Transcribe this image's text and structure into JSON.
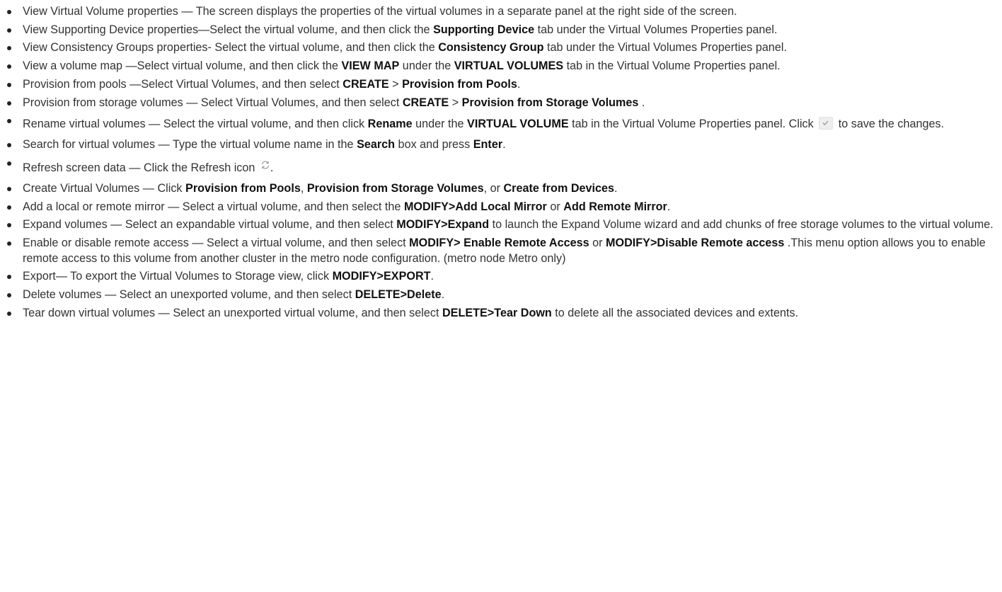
{
  "items": [
    {
      "parts": [
        {
          "t": "View Virtual Volume properties — The screen displays the properties of the virtual volumes in a separate panel at the right side of the screen."
        }
      ]
    },
    {
      "parts": [
        {
          "t": "View Supporting Device properties—Select the virtual volume, and then click the "
        },
        {
          "b": "Supporting Device"
        },
        {
          "t": " tab under the Virtual Volumes Properties panel."
        }
      ]
    },
    {
      "parts": [
        {
          "t": "View Consistency Groups properties- Select the virtual volume, and then click the "
        },
        {
          "b": "Consistency Group"
        },
        {
          "t": " tab under the Virtual Volumes Properties panel."
        }
      ]
    },
    {
      "parts": [
        {
          "t": "View a volume map —Select virtual volume, and then click the "
        },
        {
          "b": "VIEW MAP"
        },
        {
          "t": " under the "
        },
        {
          "b": "VIRTUAL VOLUMES"
        },
        {
          "t": " tab in the Virtual Volume Properties panel."
        }
      ]
    },
    {
      "parts": [
        {
          "t": "Provision from pools —Select Virtual Volumes, and then select "
        },
        {
          "b": "CREATE"
        },
        {
          "t": " > "
        },
        {
          "b": "Provision from Pools"
        },
        {
          "t": "."
        }
      ]
    },
    {
      "parts": [
        {
          "t": "Provision from storage volumes — Select Virtual Volumes, and then select "
        },
        {
          "b": "CREATE"
        },
        {
          "t": " > "
        },
        {
          "b": "Provision from Storage Volumes"
        },
        {
          "t": " ."
        }
      ]
    },
    {
      "tall": true,
      "parts": [
        {
          "t": "Rename virtual volumes — Select the virtual volume, and then click "
        },
        {
          "b": "Rename"
        },
        {
          "t": " under the "
        },
        {
          "b": "VIRTUAL VOLUME"
        },
        {
          "t": " tab in the Virtual Volume Properties panel. Click "
        },
        {
          "icon": "checkmark-icon"
        },
        {
          "t": " to save the changes."
        }
      ]
    },
    {
      "parts": [
        {
          "t": "Search for virtual volumes — Type the virtual volume name in the "
        },
        {
          "b": "Search"
        },
        {
          "t": " box and press "
        },
        {
          "b": "Enter"
        },
        {
          "t": "."
        }
      ]
    },
    {
      "tall": true,
      "parts": [
        {
          "t": "Refresh screen data — Click the Refresh icon "
        },
        {
          "icon": "refresh-icon"
        },
        {
          "t": "."
        }
      ]
    },
    {
      "parts": [
        {
          "t": "Create Virtual Volumes — Click "
        },
        {
          "b": "Provision from Pools"
        },
        {
          "t": ", "
        },
        {
          "b": "Provision from Storage Volumes"
        },
        {
          "t": ", or "
        },
        {
          "b": "Create from Devices"
        },
        {
          "t": "."
        }
      ]
    },
    {
      "parts": [
        {
          "t": "Add a local or remote mirror — Select a virtual volume, and then select the "
        },
        {
          "b": "MODIFY>Add Local Mirror"
        },
        {
          "t": " or "
        },
        {
          "b": "Add Remote Mirror"
        },
        {
          "t": "."
        }
      ]
    },
    {
      "parts": [
        {
          "t": "Expand volumes — Select an expandable virtual volume, and then select "
        },
        {
          "b": "MODIFY>Expand"
        },
        {
          "t": " to launch the Expand Volume wizard and add chunks of free storage volumes to the virtual volume."
        }
      ]
    },
    {
      "parts": [
        {
          "t": "Enable or disable remote access — Select a virtual volume, and then select "
        },
        {
          "b": "MODIFY> Enable Remote Access"
        },
        {
          "t": " or "
        },
        {
          "b": "MODIFY>Disable Remote access"
        },
        {
          "t": " .This menu option allows you to enable remote access to this volume from another cluster in the metro node configuration. (metro node Metro only)"
        }
      ]
    },
    {
      "parts": [
        {
          "t": "Export— To export the Virtual Volumes to Storage view, click "
        },
        {
          "b": "MODIFY>EXPORT"
        },
        {
          "t": "."
        }
      ]
    },
    {
      "parts": [
        {
          "t": "Delete volumes — Select an unexported volume, and then select "
        },
        {
          "b": "DELETE>Delete"
        },
        {
          "t": "."
        }
      ]
    },
    {
      "parts": [
        {
          "t": "Tear down virtual volumes — Select an unexported virtual volume, and then select "
        },
        {
          "b": "DELETE>Tear Down"
        },
        {
          "t": " to delete all the associated devices and extents."
        }
      ]
    }
  ],
  "colors": {
    "text": "#333333",
    "bold": "#111111",
    "icon": "#999999"
  }
}
